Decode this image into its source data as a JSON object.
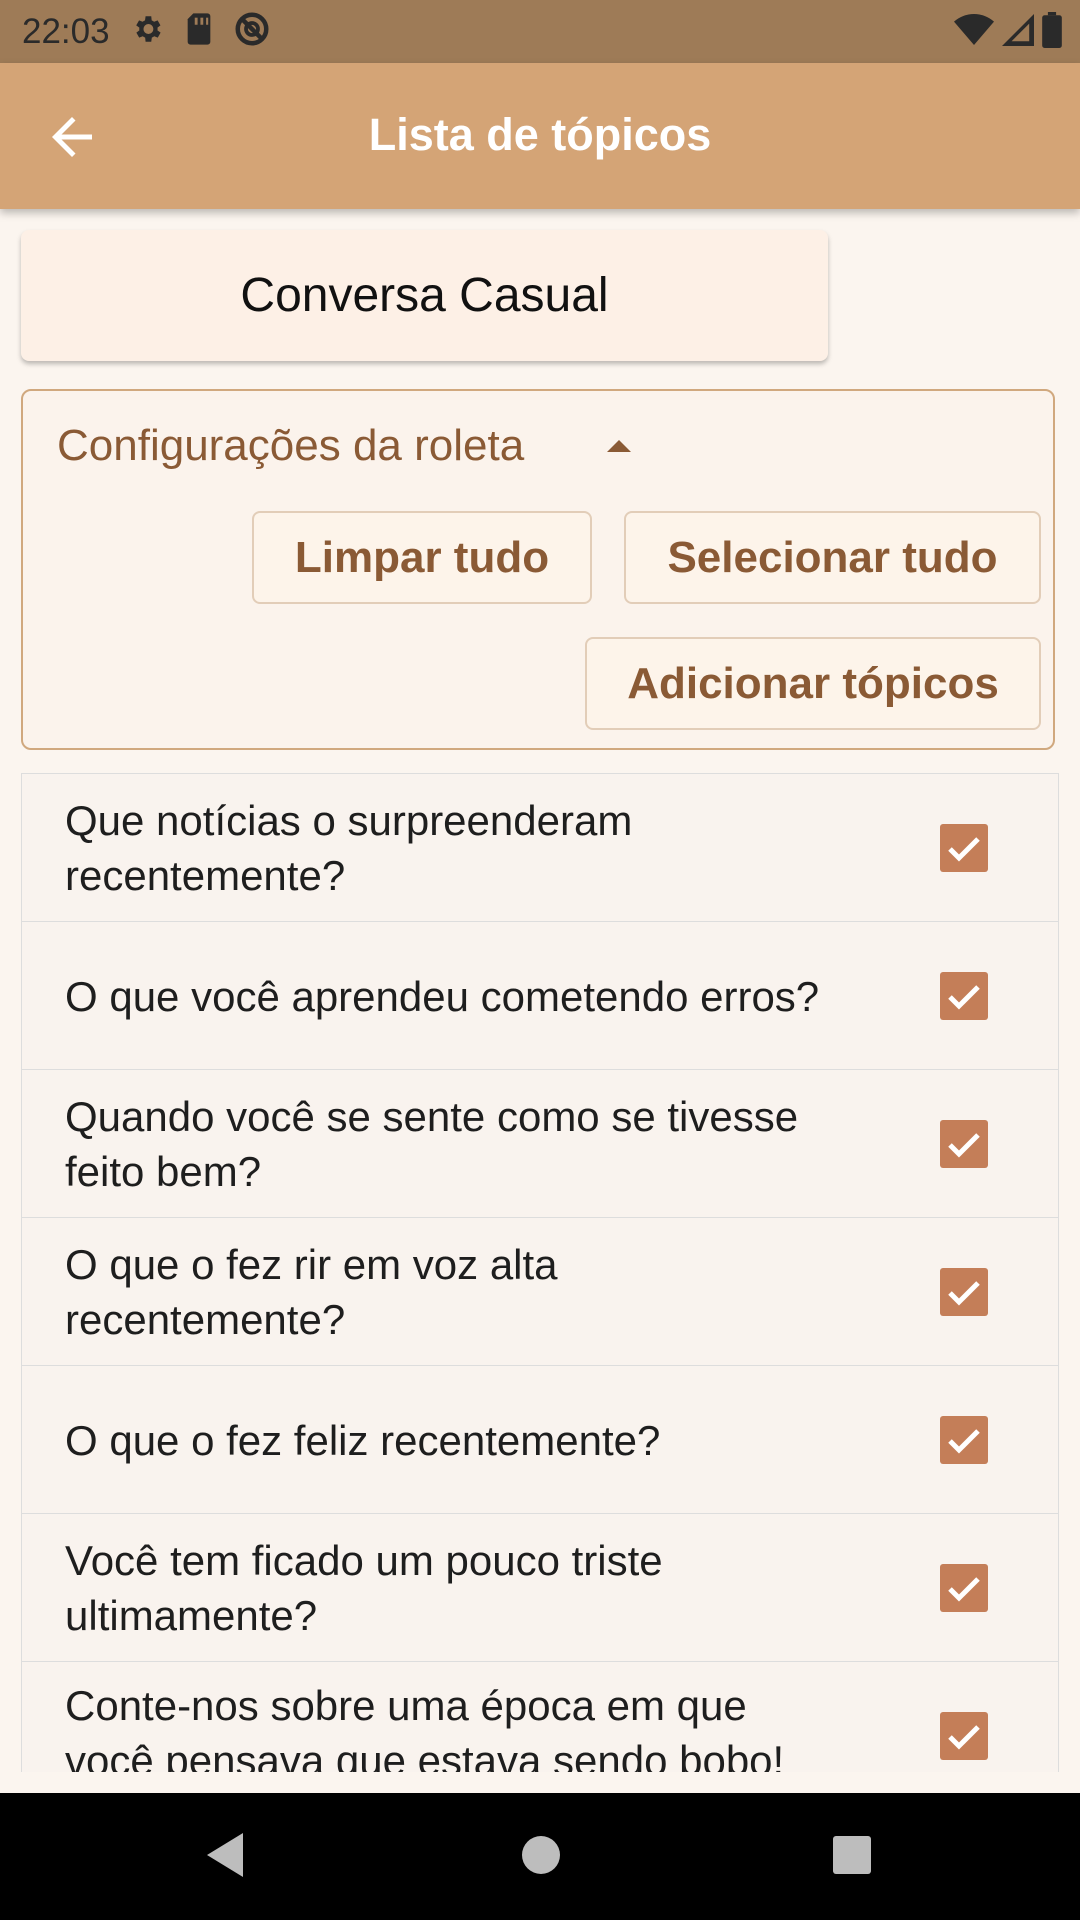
{
  "status_bar": {
    "time": "22:03",
    "icons_left": [
      "settings-icon",
      "sd-card-icon",
      "do-not-disturb-icon"
    ],
    "icons_right": [
      "wifi-icon",
      "signal-icon",
      "battery-icon"
    ]
  },
  "app_bar": {
    "title": "Lista de tópicos",
    "back_icon": "arrow-left-icon"
  },
  "category": {
    "label": "Conversa Casual"
  },
  "settings": {
    "heading": "Configurações da roleta",
    "collapse_icon": "caret-up-icon",
    "clear_all": "Limpar tudo",
    "select_all": "Selecionar tudo",
    "add_topics": "Adicionar tópicos"
  },
  "topics": [
    {
      "text": "Que notícias o surpreenderam recentemente?",
      "checked": true
    },
    {
      "text": "O que você aprendeu cometendo erros?",
      "checked": true
    },
    {
      "text": "Quando você se sente como se tivesse feito bem?",
      "checked": true
    },
    {
      "text": "O que o fez rir em voz alta recentemente?",
      "checked": true
    },
    {
      "text": "O que o fez feliz recentemente?",
      "checked": true
    },
    {
      "text": "Você tem ficado um pouco triste ultimamente?",
      "checked": true
    },
    {
      "text": "Conte-nos sobre uma época em que você pensava que estava sendo bobo!",
      "checked": true
    }
  ],
  "colors": {
    "app_bar": "#d4a476",
    "status_bar": "#9e7b57",
    "accent": "#c47e58",
    "button_text": "#8a5a35"
  },
  "nav_bar": {
    "icons": [
      "back-triangle-icon",
      "home-circle-icon",
      "recents-square-icon"
    ]
  }
}
